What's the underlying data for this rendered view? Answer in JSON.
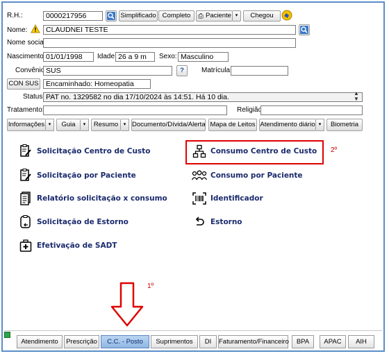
{
  "header": {
    "rh_label": "R.H.:",
    "rh_value": "0000217956",
    "btn_simplificado": "Simplificado",
    "btn_completo": "Completo",
    "btn_paciente": "Paciente",
    "btn_chegou": "Chegou"
  },
  "ui": {
    "arrow_down": "▾"
  },
  "patient": {
    "nome_label": "Nome:",
    "nome_value": "CLAUDNEI TESTE",
    "nome_social_label": "Nome social:",
    "nome_social_value": "",
    "nascimento_label": "Nascimento:",
    "nascimento_value": "01/01/1998",
    "idade_label": "Idade:",
    "idade_value": "26 a 9 m",
    "sexo_label": "Sexo:",
    "sexo_value": "Masculino",
    "convenio_label": "Convênio:",
    "convenio_value": "SUS",
    "help_glyph": "?",
    "matricula_label": "Matrícula:",
    "matricula_value": "",
    "con_sus_btn": "CON SUS",
    "encaminhado_value": "Encaminhado: Homeopatia",
    "status_label": "Status:",
    "status_value": "PAT no. 1329582 no dia 17/10/2024  às  14:51. Há 10 dia.",
    "tratamento_label": "Tratamento:",
    "tratamento_value": "",
    "religiao_label": "Religião:",
    "religiao_value": ""
  },
  "toolbar": {
    "items": [
      "Informações",
      "Guia",
      "Resumo",
      "Documento/Dívida/Alerta",
      "Mapa de Leitos",
      "Atendimento diário",
      "Biometria"
    ]
  },
  "menu": {
    "left": [
      "Solicitação Centro de Custo",
      "Solicitação por Paciente",
      "Relatório solicitação x consumo",
      "Solicitação de Estorno",
      "Efetivação de SADT"
    ],
    "right": [
      "Consumo Centro de Custo",
      "Consumo por Paciente",
      "Identificador",
      "Estorno"
    ]
  },
  "annotations": {
    "step1": "1º",
    "step2": "2º",
    "highlight_color": "#e00000"
  },
  "tabs": [
    "Atendimento",
    "Prescrição",
    "C.C. - Posto",
    "Suprimentos",
    "DI",
    "Faturamento/Financeiro",
    "BPA",
    "APAC",
    "AIH"
  ],
  "active_tab": "C.C. - Posto",
  "colors": {
    "menu_text": "#1a2a6c",
    "frame_border": "#5b8ec9",
    "active_tab": "#8fb6e2"
  }
}
